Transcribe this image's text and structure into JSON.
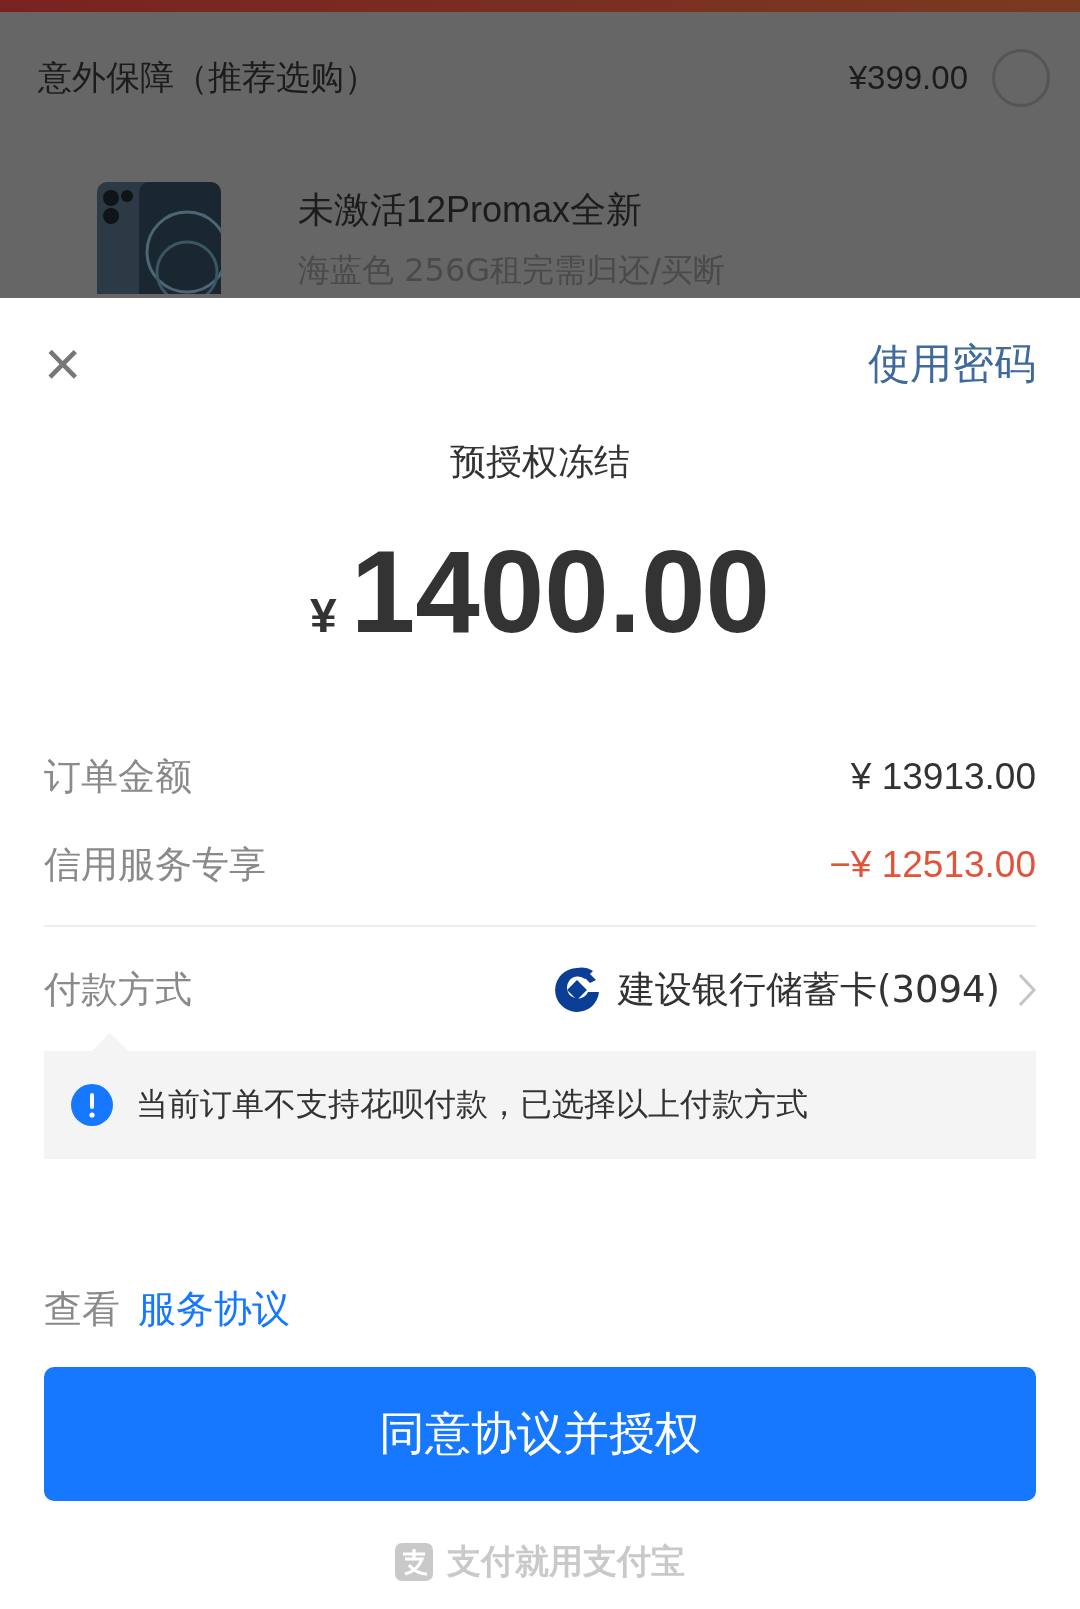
{
  "background_page": {
    "insurance": {
      "label": "意外保障（推荐选购）",
      "price": "¥399.00",
      "selected": false
    },
    "product": {
      "kind": "picture",
      "title": "未激活12Promax全新",
      "subtitle": "海蓝色 256G租完需归还/买断"
    }
  },
  "sheet": {
    "close_icon": "×",
    "password_link": "使用密码",
    "title": "预授权冻结",
    "currency": "¥",
    "amount": "1400.00",
    "rows": [
      {
        "label": "订单金额",
        "value": "¥ 13913.00",
        "kind": "normal"
      },
      {
        "label": "信用服务专享",
        "value": "−¥ 12513.00",
        "kind": "discount"
      }
    ],
    "payment": {
      "label": "付款方式",
      "method": "建设银行储蓄卡(3094)"
    },
    "notice": "当前订单不支持花呗付款，已选择以上付款方式",
    "agreement": {
      "prefix": "查看",
      "link": "服务协议"
    },
    "confirm_button": "同意协议并授权",
    "footer": "支付就用支付宝"
  }
}
